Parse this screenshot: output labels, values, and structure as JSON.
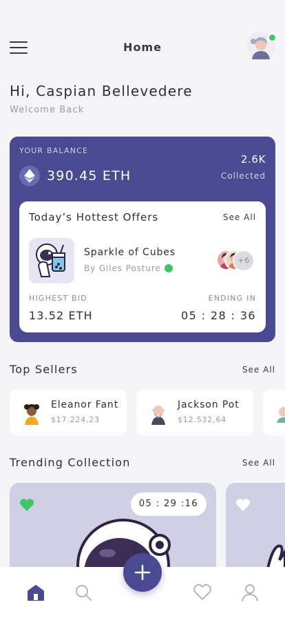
{
  "header": {
    "title": "Home",
    "menu_icon": "hamburger-menu-icon",
    "avatar_verified_color": "#3ec76a"
  },
  "greeting": {
    "title": "Hi, Caspian Bellevedere",
    "subtitle": "Welcome Back"
  },
  "balance": {
    "label": "YOUR BALANCE",
    "amount": "390.45 ETH",
    "currency_icon": "ethereum-icon",
    "collected_count": "2.6K",
    "collected_label": "Collected",
    "card_color": "#4a4a93"
  },
  "hottest_offers": {
    "title": "Today’s Hottest Offers",
    "see_all": "See All",
    "item_name": "Sparkle of Cubes",
    "item_creator": "By Giles Posture",
    "extra_bidders": "+6",
    "highest_bid_label": "HIGHEST BID",
    "highest_bid_value": "13.52 ETH",
    "ending_label": "ENDING IN",
    "ending_value": "05 : 28 : 36"
  },
  "top_sellers": {
    "title": "Top Sellers",
    "see_all": "See All",
    "items": [
      {
        "name": "Eleanor Fant",
        "amount": "$17.224,23"
      },
      {
        "name": "Jackson Pot",
        "amount": "$12.532,64"
      }
    ]
  },
  "trending": {
    "title": "Trending Collection",
    "see_all": "See All",
    "cards": [
      {
        "timer": "05 : 29 :16",
        "favorited": true
      },
      {
        "favorited": false
      }
    ]
  },
  "bottom_nav": {
    "items": [
      "home-icon",
      "search-icon",
      "add-icon",
      "heart-icon",
      "profile-icon"
    ],
    "active": "home-icon"
  }
}
